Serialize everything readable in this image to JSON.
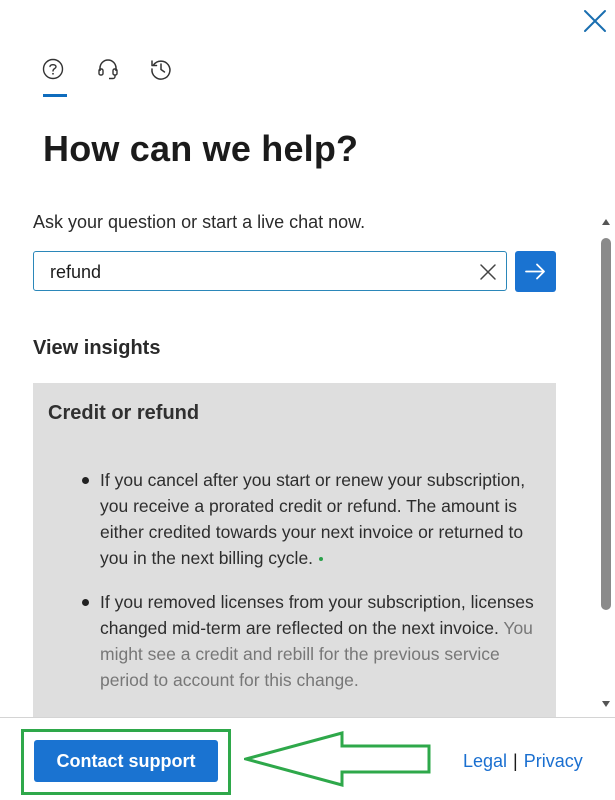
{
  "panel": {
    "title": "How can we help?",
    "prompt": "Ask your question or start a live chat now."
  },
  "tabs": [
    {
      "name": "help",
      "icon": "help-circle-icon",
      "active": true
    },
    {
      "name": "live-chat",
      "icon": "headset-icon",
      "active": false
    },
    {
      "name": "history",
      "icon": "history-icon",
      "active": false
    }
  ],
  "search": {
    "value": "refund",
    "clear_icon": "close-icon",
    "submit_icon": "arrow-right-icon"
  },
  "insights": {
    "heading": "View insights",
    "card": {
      "title": "Credit or refund",
      "bullets": [
        "If you cancel after you start or renew your subscription, you receive a prorated credit or refund. The amount is either credited towards your next invoice or returned to you in the next billing cycle.",
        {
          "main": "If you removed licenses from your subscription, licenses changed mid-term are reflected on the next invoice.",
          "faded": "You might see a credit and rebill for the previous service period to account for this change."
        }
      ]
    }
  },
  "footer": {
    "contact_label": "Contact support",
    "legal_label": "Legal",
    "separator": "|",
    "privacy_label": "Privacy"
  },
  "colors": {
    "accent": "#1a73d1",
    "tab_underline": "#0f6cbd",
    "card_background": "#dedede",
    "annotation_green": "#2ea84a"
  }
}
